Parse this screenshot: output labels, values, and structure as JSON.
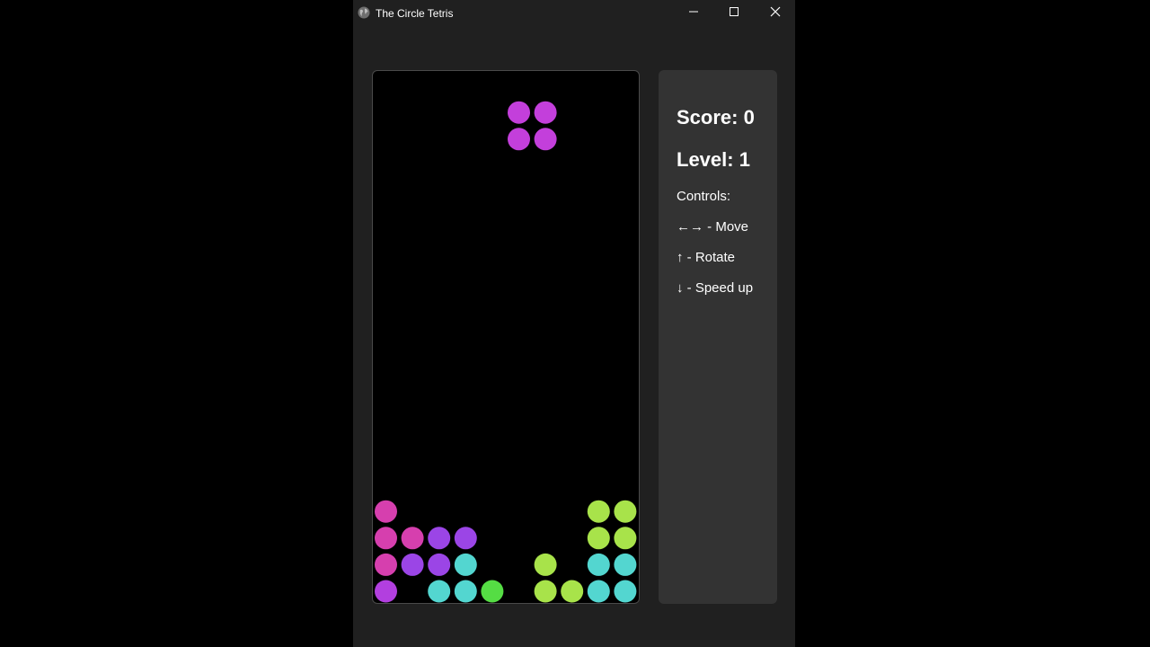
{
  "window": {
    "title": "The Circle Tetris",
    "icon": "globe-icon",
    "controls": [
      "minimize-icon",
      "maximize-icon",
      "close-icon"
    ]
  },
  "game": {
    "columns": 10,
    "rows": 20,
    "colors": {
      "pink": "#d63fae",
      "purple": "#9b45e6",
      "violet": "#b23fdf",
      "cyan": "#53d6d0",
      "green": "#55dd44",
      "lime": "#a8e34a",
      "falling": "#c33fdb"
    },
    "falling_piece": {
      "shape": "O",
      "color_key": "falling",
      "cells": [
        [
          5,
          1
        ],
        [
          6,
          1
        ],
        [
          5,
          2
        ],
        [
          6,
          2
        ]
      ]
    },
    "settled": [
      {
        "col": 0,
        "row": 16,
        "color_key": "pink"
      },
      {
        "col": 8,
        "row": 16,
        "color_key": "lime"
      },
      {
        "col": 9,
        "row": 16,
        "color_key": "lime"
      },
      {
        "col": 0,
        "row": 17,
        "color_key": "pink"
      },
      {
        "col": 1,
        "row": 17,
        "color_key": "pink"
      },
      {
        "col": 2,
        "row": 17,
        "color_key": "purple"
      },
      {
        "col": 3,
        "row": 17,
        "color_key": "purple"
      },
      {
        "col": 8,
        "row": 17,
        "color_key": "lime"
      },
      {
        "col": 9,
        "row": 17,
        "color_key": "lime"
      },
      {
        "col": 0,
        "row": 18,
        "color_key": "pink"
      },
      {
        "col": 1,
        "row": 18,
        "color_key": "purple"
      },
      {
        "col": 2,
        "row": 18,
        "color_key": "purple"
      },
      {
        "col": 3,
        "row": 18,
        "color_key": "cyan"
      },
      {
        "col": 6,
        "row": 18,
        "color_key": "lime"
      },
      {
        "col": 8,
        "row": 18,
        "color_key": "cyan"
      },
      {
        "col": 9,
        "row": 18,
        "color_key": "cyan"
      },
      {
        "col": 0,
        "row": 19,
        "color_key": "violet"
      },
      {
        "col": 2,
        "row": 19,
        "color_key": "cyan"
      },
      {
        "col": 3,
        "row": 19,
        "color_key": "cyan"
      },
      {
        "col": 4,
        "row": 19,
        "color_key": "green"
      },
      {
        "col": 6,
        "row": 19,
        "color_key": "lime"
      },
      {
        "col": 7,
        "row": 19,
        "color_key": "lime"
      },
      {
        "col": 8,
        "row": 19,
        "color_key": "cyan"
      },
      {
        "col": 9,
        "row": 19,
        "color_key": "cyan"
      }
    ]
  },
  "panel": {
    "score_text": "Score: 0",
    "level_text": "Level: 1",
    "controls_heading": "Controls:",
    "controls": [
      "←→ - Move",
      "↑ - Rotate",
      "↓ - Speed up"
    ]
  }
}
